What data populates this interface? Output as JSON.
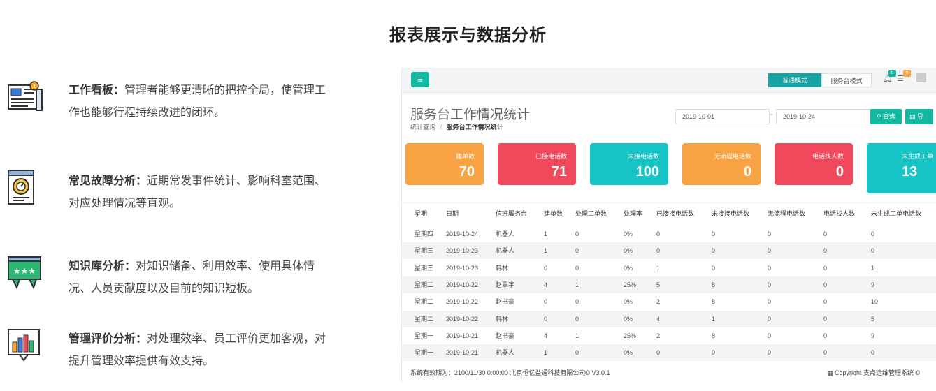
{
  "page_title": "报表展示与数据分析",
  "features": [
    {
      "title": "工作看板：",
      "text1": "管理者能够更清晰的把控全局，使管理工",
      "text2": "作也能够行程持续改进的闭环。"
    },
    {
      "title": "常见故障分析：",
      "text1": "近期常发事件统计、影响科室范围、",
      "text2": "对应处理情况等直观。"
    },
    {
      "title": "知识库分析：",
      "text1": "对知识储备、利用效率、使用具体情",
      "text2": "况、人员贡献度以及目前的知识短板。"
    },
    {
      "title": "管理评价分析：",
      "text1": "对处理效率、员工评价更加客观，对",
      "text2": "提升管理效率提供有效支持。"
    }
  ],
  "screenshot": {
    "menu_icon": "≡",
    "mode_normal": "普通模式",
    "mode_service": "服务台模式",
    "badge_bell": "0",
    "badge_list": "0",
    "report_title": "服务台工作情况统计",
    "crumb_parent": "统计查询",
    "crumb_sep": "/",
    "crumb_current": "服务台工作情况统计",
    "date_from": "2019-10-01",
    "date_sep": "-",
    "date_to": "2019-10-24",
    "btn_query": "查询",
    "btn_export": "导",
    "cards": [
      {
        "label": "建单数",
        "value": "70",
        "color": "#f8a343"
      },
      {
        "label": "已接电话数",
        "value": "71",
        "color": "#f0495b"
      },
      {
        "label": "未接电话数",
        "value": "100",
        "color": "#16c4c6"
      },
      {
        "label": "无流程电话数",
        "value": "0",
        "color": "#f8a343"
      },
      {
        "label": "电话找人数",
        "value": "0",
        "color": "#f0495b"
      },
      {
        "label": "未生成工单",
        "value": "13",
        "color": "#16c4c6"
      }
    ],
    "table": {
      "headers": [
        "星期",
        "日期",
        "值班服务台",
        "建单数",
        "处理工单数",
        "处理率",
        "已接接电话数",
        "未接接电话数",
        "无流程电话数",
        "电话找人数",
        "未生成工单电话数"
      ],
      "rows": [
        [
          "星期四",
          "2019-10-24",
          "机器人",
          "1",
          "0",
          "0%",
          "0",
          "0",
          "0",
          "0",
          "0"
        ],
        [
          "星期三",
          "2019-10-23",
          "机器人",
          "1",
          "0",
          "0%",
          "0",
          "0",
          "0",
          "0",
          "0"
        ],
        [
          "星期三",
          "2019-10-23",
          "韩林",
          "0",
          "0",
          "0%",
          "1",
          "0",
          "0",
          "0",
          "1"
        ],
        [
          "星期二",
          "2019-10-22",
          "赵翠宇",
          "4",
          "1",
          "25%",
          "5",
          "8",
          "0",
          "0",
          "9"
        ],
        [
          "星期二",
          "2019-10-22",
          "赵书豪",
          "0",
          "0",
          "0%",
          "2",
          "8",
          "0",
          "0",
          "10"
        ],
        [
          "星期二",
          "2019-10-22",
          "韩林",
          "0",
          "0",
          "0%",
          "4",
          "1",
          "0",
          "0",
          "5"
        ],
        [
          "星期一",
          "2019-10-21",
          "赵书豪",
          "4",
          "1",
          "25%",
          "2",
          "8",
          "0",
          "0",
          "9"
        ],
        [
          "星期一",
          "2019-10-21",
          "机器人",
          "1",
          "0",
          "0%",
          "0",
          "0",
          "0",
          "0",
          "0"
        ]
      ]
    },
    "footer_left": "系统有效期为：2100/11/30 0:00:00 北京恒亿益通科技有限公司© V3.0.1",
    "footer_right": "Copyright 支点运维管理系统 ©"
  },
  "colors": {
    "teal": "#12b8a0",
    "orange": "#f8a343",
    "red": "#f0495b",
    "cyan": "#16c4c6"
  }
}
